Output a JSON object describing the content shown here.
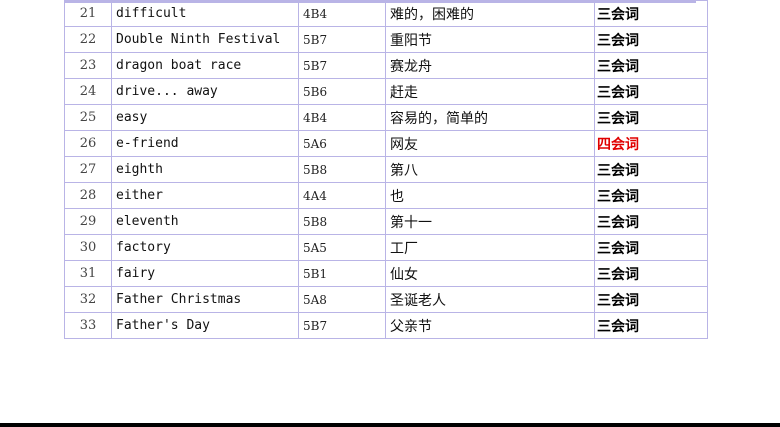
{
  "rows": [
    {
      "num": "21",
      "word": "difficult",
      "unit": "4B4",
      "meaning": "难的，困难的",
      "level": "三会词",
      "highlight": false
    },
    {
      "num": "22",
      "word": "Double Ninth Festival",
      "unit": "5B7",
      "meaning": "重阳节",
      "level": "三会词",
      "highlight": false
    },
    {
      "num": "23",
      "word": "dragon boat race",
      "unit": "5B7",
      "meaning": "赛龙舟",
      "level": "三会词",
      "highlight": false
    },
    {
      "num": "24",
      "word": "drive... away",
      "unit": "5B6",
      "meaning": "赶走",
      "level": "三会词",
      "highlight": false
    },
    {
      "num": "25",
      "word": "easy",
      "unit": "4B4",
      "meaning": "容易的，简单的",
      "level": "三会词",
      "highlight": false
    },
    {
      "num": "26",
      "word": "e-friend",
      "unit": "5A6",
      "meaning": "网友",
      "level": "四会词",
      "highlight": true
    },
    {
      "num": "27",
      "word": "eighth",
      "unit": "5B8",
      "meaning": "第八",
      "level": "三会词",
      "highlight": false
    },
    {
      "num": "28",
      "word": "either",
      "unit": "4A4",
      "meaning": "也",
      "level": "三会词",
      "highlight": false
    },
    {
      "num": "29",
      "word": "eleventh",
      "unit": "5B8",
      "meaning": "第十一",
      "level": "三会词",
      "highlight": false
    },
    {
      "num": "30",
      "word": "factory",
      "unit": "5A5",
      "meaning": "工厂",
      "level": "三会词",
      "highlight": false
    },
    {
      "num": "31",
      "word": "fairy",
      "unit": "5B1",
      "meaning": "仙女",
      "level": "三会词",
      "highlight": false
    },
    {
      "num": "32",
      "word": "Father Christmas",
      "unit": "5A8",
      "meaning": "圣诞老人",
      "level": "三会词",
      "highlight": false
    },
    {
      "num": "33",
      "word": "Father's Day",
      "unit": "5B7",
      "meaning": "父亲节",
      "level": "三会词",
      "highlight": false
    }
  ],
  "colors": {
    "border": "#b9b4e6",
    "highlight_text": "#e00000"
  }
}
